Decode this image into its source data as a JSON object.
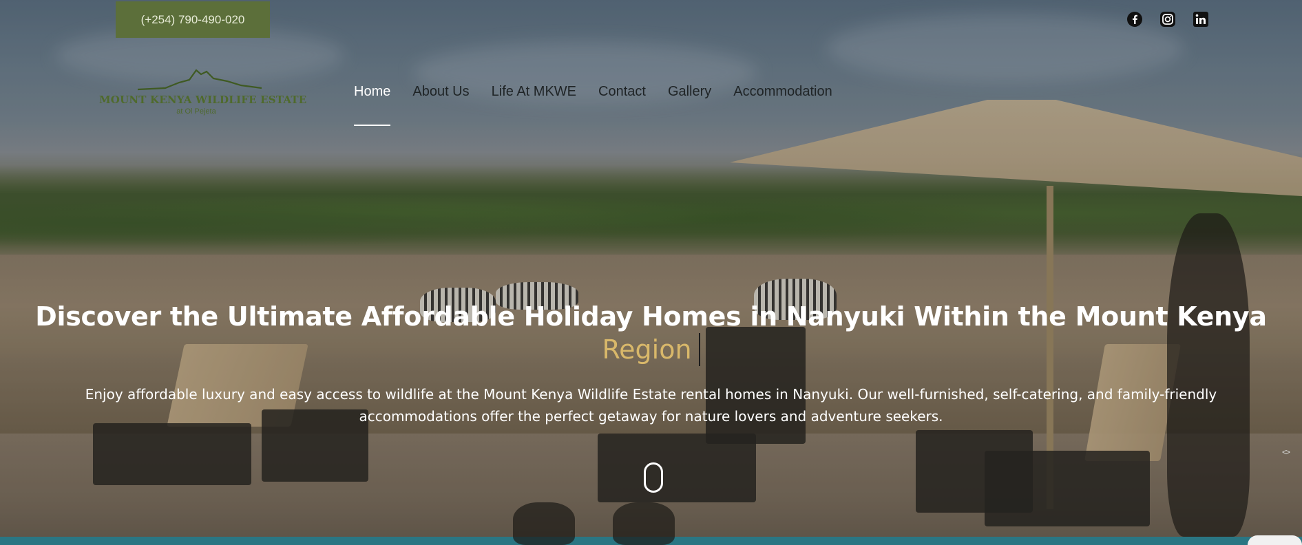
{
  "header": {
    "phone": "(+254) 790-490-020",
    "socials": [
      {
        "icon": "facebook-icon"
      },
      {
        "icon": "instagram-icon"
      },
      {
        "icon": "linkedin-icon"
      }
    ]
  },
  "logo": {
    "name": "MOUNT KENYA WILDLIFE ESTATE",
    "sub": "at Ol Pejeta"
  },
  "nav": {
    "items": [
      {
        "label": "Home",
        "active": true
      },
      {
        "label": "About Us"
      },
      {
        "label": "Life At MKWE"
      },
      {
        "label": "Contact"
      },
      {
        "label": "Gallery"
      },
      {
        "label": "Accommodation"
      }
    ]
  },
  "hero": {
    "headline": "Discover the Ultimate Affordable Holiday Homes in Nanyuki Within the Mount Kenya",
    "headline_highlight": "Region",
    "subtext": "Enjoy affordable luxury and easy access to wildlife at the Mount Kenya Wildlife Estate rental homes in Nanyuki. Our well-furnished, self-catering, and family-friendly accommodations offer the perfect getaway for nature lovers and adventure seekers."
  },
  "colors": {
    "phone_bg": "#5c6f3a",
    "logo_green": "#4f6a2c",
    "highlight": "#d9b86a",
    "nav_text": "#1f2426"
  }
}
